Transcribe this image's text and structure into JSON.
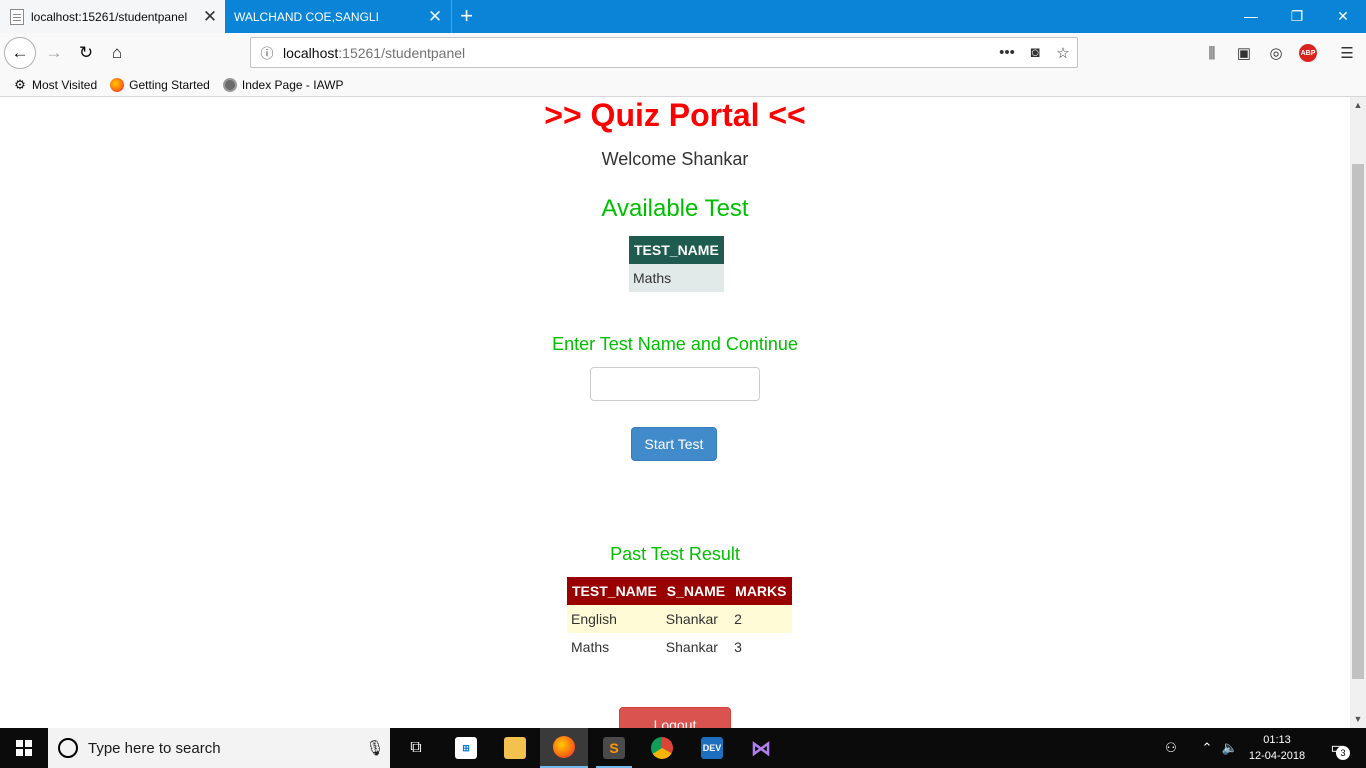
{
  "browser": {
    "tabs": [
      {
        "label": "localhost:15261/studentpanel",
        "active": true
      },
      {
        "label": "WALCHAND COE,SANGLI",
        "active": false
      }
    ],
    "new_tab": "+",
    "close_glyph": "✕",
    "window_controls": {
      "minimize": "—",
      "restore": "❐",
      "close": "✕"
    },
    "url": {
      "host": "localhost",
      "rest": ":15261/studentpanel"
    },
    "page_actions": "•••",
    "bookmarks": [
      {
        "label": "Most Visited",
        "icon": "gear-icon"
      },
      {
        "label": "Getting Started",
        "icon": "firefox-icon"
      },
      {
        "label": "Index Page - IAWP",
        "icon": "globe-icon"
      }
    ],
    "abp_label": "ABP"
  },
  "page": {
    "title": ">> Quiz Portal <<",
    "welcome": "Welcome Shankar",
    "available_heading": "Available Test",
    "available_table": {
      "header": "TEST_NAME",
      "rows": [
        "Maths"
      ]
    },
    "enter_heading": "Enter Test Name and Continue",
    "test_input_value": "",
    "start_button": "Start Test",
    "past_heading": "Past Test Result",
    "past_table": {
      "headers": [
        "TEST_NAME",
        "S_NAME",
        "MARKS"
      ],
      "rows": [
        [
          "English",
          "Shankar",
          "2"
        ],
        [
          "Maths",
          "Shankar",
          "3"
        ]
      ]
    },
    "logout_button": "Logout"
  },
  "taskbar": {
    "search_placeholder": "Type here to search",
    "time": "01:13",
    "date": "12-04-2018",
    "notification_count": "3",
    "dev_label": "DEV"
  },
  "colors": {
    "title_red": "#ff0000",
    "heading_green": "#00bf00",
    "available_header": "#1f5c4f",
    "past_header": "#990000",
    "start_button": "#428bca",
    "logout_button": "#d9534f",
    "firefox_tabbar": "#0a84d6"
  }
}
